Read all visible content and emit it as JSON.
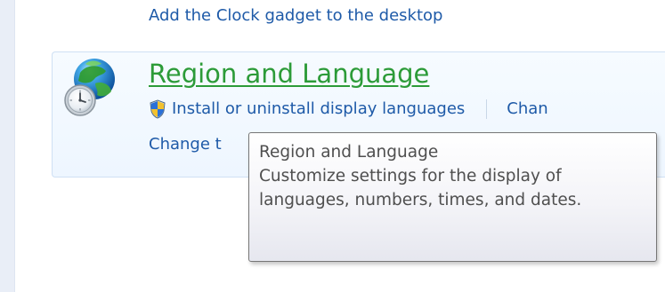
{
  "control_panel": {
    "top_link": "Add the Clock gadget to the desktop",
    "category": {
      "title": "Region and Language",
      "tasks": [
        "Install or uninstall display languages",
        "Chan"
      ],
      "second_task": "Change t"
    },
    "icons": {
      "category_icon": "globe-clock-icon",
      "task_icon": "uac-shield-icon"
    }
  },
  "tooltip": {
    "title": "Region and Language",
    "description": "Customize settings for the display of languages, numbers, times, and dates."
  },
  "colors": {
    "link": "#1e5aa8",
    "category_title": "#2c9b38",
    "tooltip_text": "#4f4f4f"
  }
}
